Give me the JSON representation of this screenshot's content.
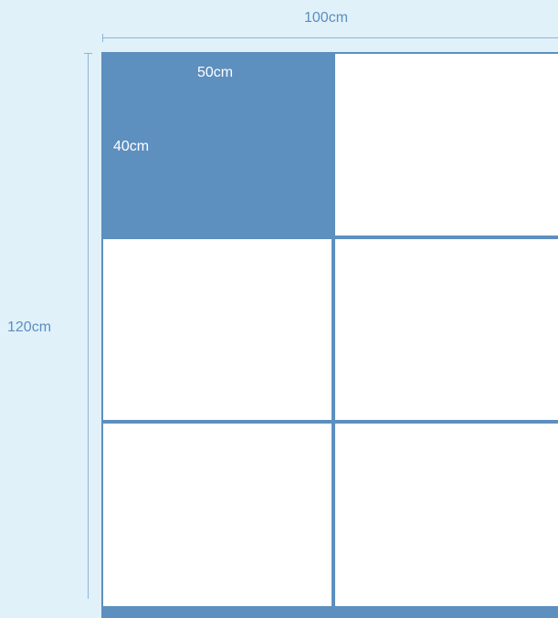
{
  "dimensions": {
    "total_width": "100cm",
    "total_height": "120cm"
  },
  "selected_panel": {
    "width": "50cm",
    "height": "40cm"
  },
  "grid": {
    "columns": 2,
    "rows": 3
  },
  "colors": {
    "background": "#e1f1f9",
    "accent": "#5d8fbf",
    "panel": "#ffffff",
    "dimension_text": "#5a8fbf"
  }
}
